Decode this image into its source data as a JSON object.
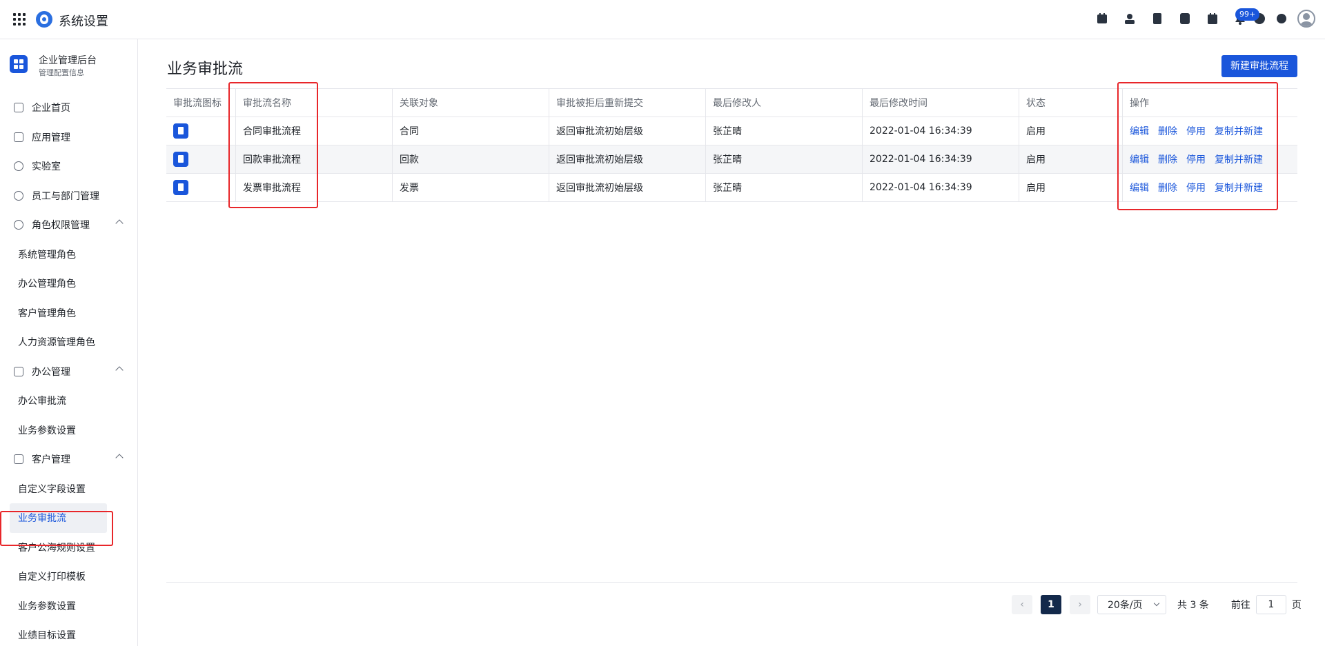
{
  "header": {
    "app_title": "系统设置",
    "notification_badge": "99+",
    "icons": [
      "calendar-check-icon",
      "contacts-icon",
      "document-icon",
      "phone-icon",
      "calendar-icon",
      "bell-icon",
      "help-icon",
      "gear-icon",
      "user-avatar-icon"
    ]
  },
  "sidebar": {
    "org_name": "企业管理后台",
    "org_subtitle": "管理配置信息",
    "items": [
      {
        "label": "企业首页",
        "icon": "home-icon"
      },
      {
        "label": "应用管理",
        "icon": "apps-icon"
      },
      {
        "label": "实验室",
        "icon": "bulb-icon"
      },
      {
        "label": "员工与部门管理",
        "icon": "users-icon"
      },
      {
        "label": "角色权限管理",
        "icon": "role-icon",
        "children": [
          "系统管理角色",
          "办公管理角色",
          "客户管理角色",
          "人力资源管理角色"
        ]
      },
      {
        "label": "办公管理",
        "icon": "briefcase-icon",
        "children": [
          "办公审批流",
          "业务参数设置"
        ]
      },
      {
        "label": "客户管理",
        "icon": "building-icon",
        "children": [
          "自定义字段设置",
          "业务审批流",
          "客户公海规则设置",
          "自定义打印模板",
          "业务参数设置",
          "业绩目标设置"
        ]
      }
    ],
    "active_item": "业务审批流"
  },
  "main": {
    "title": "业务审批流",
    "new_button": "新建审批流程",
    "columns": [
      "审批流图标",
      "审批流名称",
      "关联对象",
      "审批被拒后重新提交",
      "最后修改人",
      "最后修改时间",
      "状态",
      "操作"
    ],
    "rows": [
      {
        "name": "合同审批流程",
        "object": "合同",
        "resubmit": "返回审批流初始层级",
        "modifier": "张芷晴",
        "time": "2022-01-04 16:34:39",
        "status": "启用"
      },
      {
        "name": "回款审批流程",
        "object": "回款",
        "resubmit": "返回审批流初始层级",
        "modifier": "张芷晴",
        "time": "2022-01-04 16:34:39",
        "status": "启用"
      },
      {
        "name": "发票审批流程",
        "object": "发票",
        "resubmit": "返回审批流初始层级",
        "modifier": "张芷晴",
        "time": "2022-01-04 16:34:39",
        "status": "启用"
      }
    ],
    "actions": {
      "edit": "编辑",
      "delete": "删除",
      "disable": "停用",
      "copy": "复制并新建"
    }
  },
  "pagination": {
    "prev": "‹",
    "next": "›",
    "current_page": "1",
    "page_size": "20条/页",
    "total": "共 3 条",
    "goto_label": "前往",
    "goto_value": "1",
    "goto_suffix": "页"
  },
  "colors": {
    "accent": "#1a56db",
    "highlight": "#e8262a",
    "active_page": "#13294b"
  }
}
